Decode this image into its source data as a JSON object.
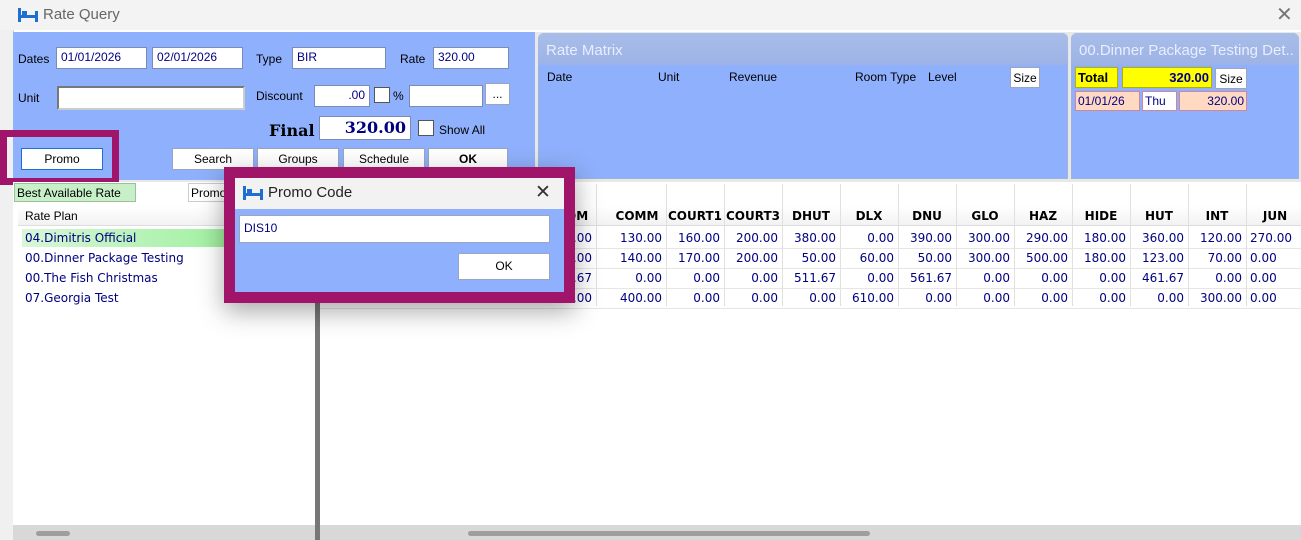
{
  "window": {
    "title": "Rate Query",
    "close": "✕"
  },
  "form": {
    "dates_label": "Dates",
    "date_from": "01/01/2026",
    "date_to": "02/01/2026",
    "type_label": "Type",
    "type_value": "BIR",
    "rate_label": "Rate",
    "rate_value": "320.00",
    "unit_label": "Unit",
    "unit_value": "",
    "discount_label": "Discount",
    "discount_value": ".00",
    "percent_label": "%",
    "discount_extra": "",
    "ellipsis": "...",
    "final_label": "Final",
    "final_value": "320.00",
    "show_all_label": "Show All",
    "promo_button": "Promo",
    "search_button": "Search",
    "groups_button": "Groups",
    "schedule_button": "Schedule",
    "ok_button": "OK"
  },
  "rate_matrix": {
    "title": "Rate Matrix",
    "headers": [
      "Date",
      "Unit",
      "Revenue",
      "Room Type",
      "Level"
    ],
    "size_button": "Size"
  },
  "package_panel": {
    "title": "00.Dinner Package Testing Det...",
    "total_label": "Total",
    "total_value": "320.00",
    "size_button": "Size",
    "row": {
      "date": "01/01/26",
      "day": "Thu",
      "amount": "320.00"
    }
  },
  "tabs": {
    "best_rate": "Best Available Rate",
    "promo": "Promo"
  },
  "rate_plans": {
    "header": "Rate Plan",
    "items": [
      "04.Dimitris Official",
      "00.Dinner Package Testing",
      "00.The Fish Christmas",
      "07.Georgia Test"
    ]
  },
  "grid": {
    "columns": [
      "OM",
      "COMM",
      "COURT1",
      "COURT3",
      "DHUT",
      "DLX",
      "DNU",
      "GLO",
      "HAZ",
      "HIDE",
      "HUT",
      "INT",
      "JUN"
    ],
    "rows": [
      [
        "50.00",
        "130.00",
        "160.00",
        "200.00",
        "380.00",
        "0.00",
        "390.00",
        "300.00",
        "290.00",
        "180.00",
        "360.00",
        "120.00",
        "270.00"
      ],
      [
        "21.00",
        "140.00",
        "170.00",
        "200.00",
        "50.00",
        "60.00",
        "50.00",
        "300.00",
        "500.00",
        "180.00",
        "123.00",
        "70.00",
        "0.00"
      ],
      [
        "41.67",
        "0.00",
        "0.00",
        "0.00",
        "511.67",
        "0.00",
        "561.67",
        "0.00",
        "0.00",
        "0.00",
        "461.67",
        "0.00",
        "0.00"
      ],
      [
        "0.00",
        "400.00",
        "0.00",
        "0.00",
        "0.00",
        "610.00",
        "0.00",
        "0.00",
        "0.00",
        "0.00",
        "0.00",
        "300.00",
        "0.00"
      ]
    ]
  },
  "promo_dialog": {
    "title": "Promo Code",
    "close": "✕",
    "code_value": "DIS10",
    "ok_button": "OK"
  },
  "colors": {
    "panel_blue": "#8fb0fc",
    "highlight": "#a0156a",
    "text_navy": "#000080"
  }
}
